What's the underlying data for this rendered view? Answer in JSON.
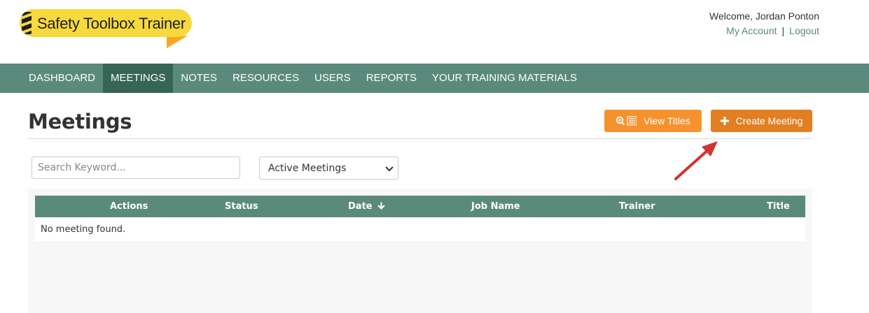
{
  "brand": {
    "name": "Safety Toolbox Trainer"
  },
  "user": {
    "welcome": "Welcome, Jordan Ponton",
    "my_account": "My Account",
    "separator": "|",
    "logout": "Logout"
  },
  "nav": {
    "items": [
      {
        "label": "DASHBOARD",
        "active": false
      },
      {
        "label": "MEETINGS",
        "active": true
      },
      {
        "label": "NOTES",
        "active": false
      },
      {
        "label": "RESOURCES",
        "active": false
      },
      {
        "label": "USERS",
        "active": false
      },
      {
        "label": "REPORTS",
        "active": false
      },
      {
        "label": "YOUR TRAINING MATERIALS",
        "active": false
      }
    ]
  },
  "page": {
    "title": "Meetings",
    "view_titles_label": "View Titles",
    "create_meeting_label": "Create Meeting"
  },
  "filters": {
    "search_placeholder": "Search Keyword...",
    "search_value": "",
    "status_selected": "Active Meetings"
  },
  "table": {
    "columns": [
      "Actions",
      "Status",
      "Date",
      "Job Name",
      "Trainer",
      "Title"
    ],
    "empty_message": "No meeting found."
  },
  "colors": {
    "nav_bg": "#5a8a7b",
    "nav_active": "#376555",
    "view_titles_btn": "#f5922e",
    "create_btn": "#e27f22",
    "annotation_arrow": "#d0352f",
    "logo_yellow": "#f7d93d",
    "logo_tail": "#f7a823"
  },
  "icons": {
    "view_titles": "search-list-icon",
    "create": "plus-icon",
    "date_sort": "arrow-down-icon",
    "select": "chevron-down-icon"
  }
}
